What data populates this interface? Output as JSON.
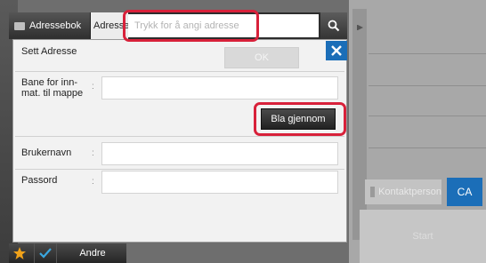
{
  "toolbar": {
    "addressbook_tab": "Adressebok",
    "address_tab": "Adresse",
    "address_placeholder": "Trykk for å angi adresse",
    "search_icon": "search-icon"
  },
  "dialog": {
    "title": "Sett Adresse",
    "ok_label": "OK",
    "close_icon": "close-icon",
    "path_label_line1": "Bane for inn-",
    "path_label_line2": "mat. til mappe",
    "path_value": "",
    "browse_label": "Bla gjennom",
    "username_label": "Brukernavn",
    "username_value": "",
    "password_label": "Passord",
    "password_value": "",
    "separator": ":"
  },
  "bottom_bar": {
    "star_icon": "star-icon",
    "check_icon": "check-icon",
    "other_label": "Andre"
  },
  "right_panel": {
    "contacts_label": "Kontaktperson",
    "ca_label": "CA",
    "start_label": "Start"
  },
  "colors": {
    "highlight": "#d8213a",
    "accent_blue": "#1b6eb8"
  }
}
